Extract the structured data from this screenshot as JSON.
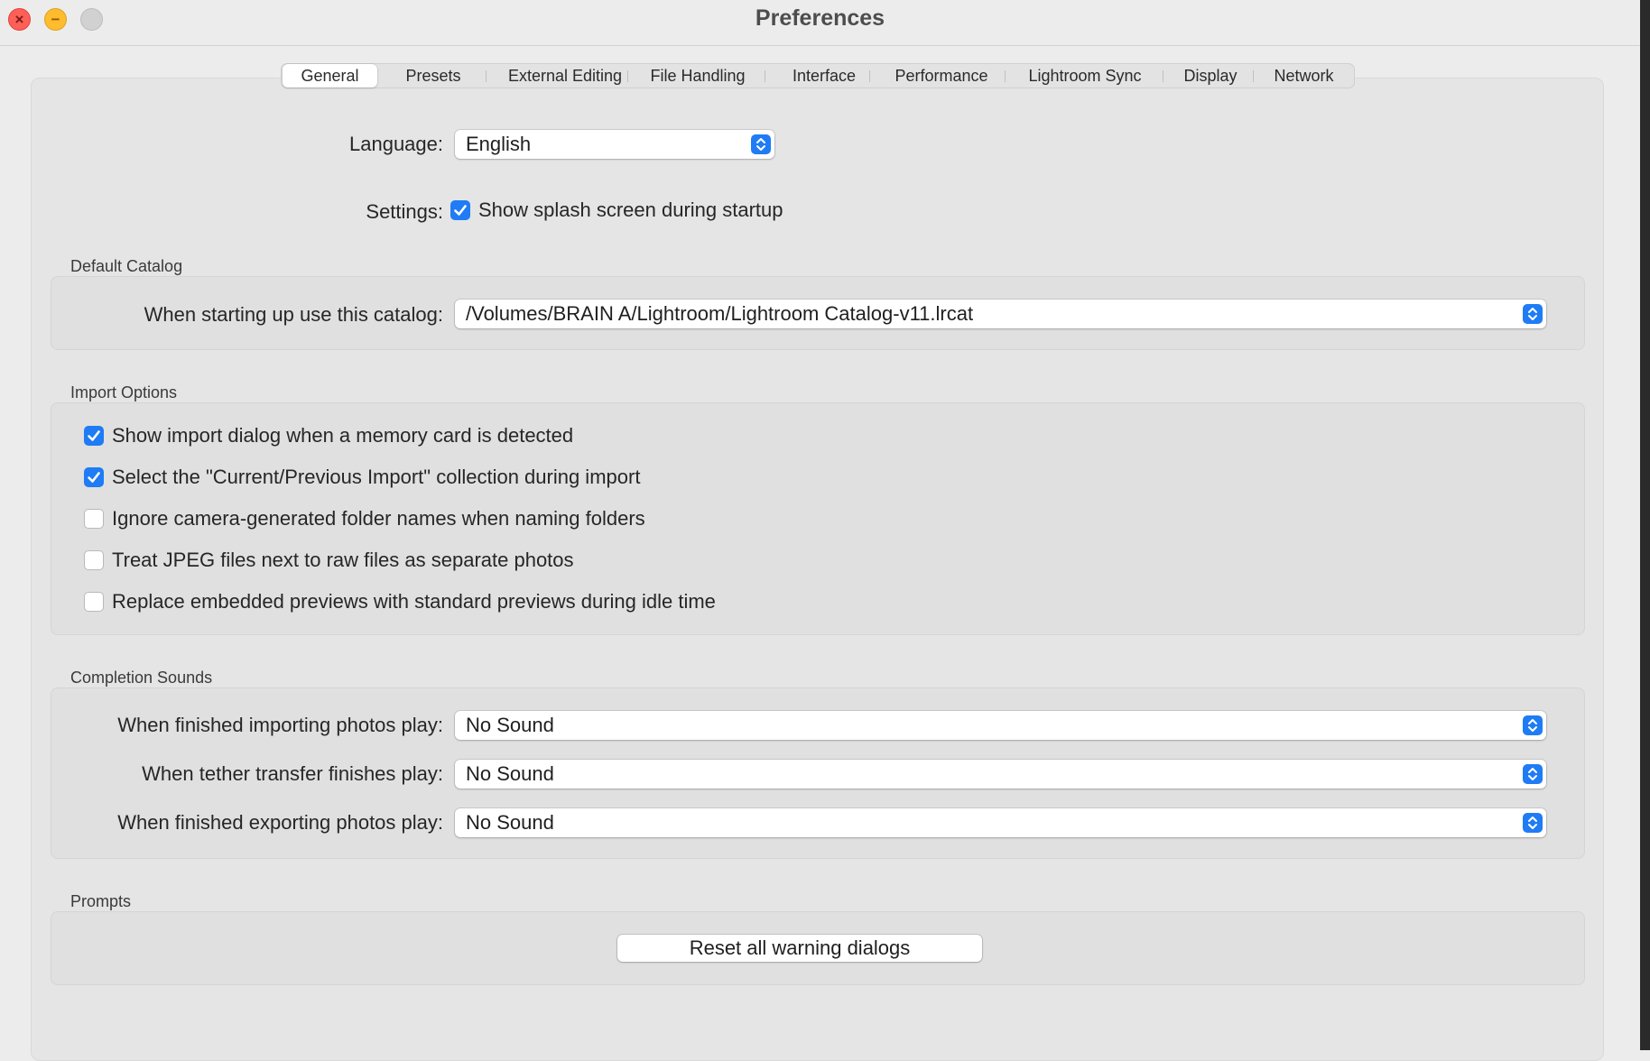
{
  "window": {
    "title": "Preferences"
  },
  "tabs": [
    {
      "label": "General",
      "active": true
    },
    {
      "label": "Presets"
    },
    {
      "label": "External Editing"
    },
    {
      "label": "File Handling"
    },
    {
      "label": "Interface"
    },
    {
      "label": "Performance"
    },
    {
      "label": "Lightroom Sync"
    },
    {
      "label": "Display"
    },
    {
      "label": "Network"
    }
  ],
  "general": {
    "language_label": "Language:",
    "language_value": "English",
    "settings_label": "Settings:",
    "splash_label": "Show splash screen during startup",
    "splash_checked": true
  },
  "default_catalog": {
    "title": "Default Catalog",
    "label": "When starting up use this catalog:",
    "value": "/Volumes/BRAIN A/Lightroom/Lightroom Catalog-v11.lrcat"
  },
  "import_options": {
    "title": "Import Options",
    "options": [
      {
        "label": "Show import dialog when a memory card is detected",
        "checked": true
      },
      {
        "label": "Select the \"Current/Previous Import\" collection during import",
        "checked": true
      },
      {
        "label": "Ignore camera-generated folder names when naming folders",
        "checked": false
      },
      {
        "label": "Treat JPEG files next to raw files as separate photos",
        "checked": false
      },
      {
        "label": "Replace embedded previews with standard previews during idle time",
        "checked": false
      }
    ]
  },
  "completion_sounds": {
    "title": "Completion Sounds",
    "rows": [
      {
        "label": "When finished importing photos play:",
        "value": "No Sound"
      },
      {
        "label": "When tether transfer finishes play:",
        "value": "No Sound"
      },
      {
        "label": "When finished exporting photos play:",
        "value": "No Sound"
      }
    ]
  },
  "prompts": {
    "title": "Prompts",
    "reset_button": "Reset all warning dialogs"
  },
  "colors": {
    "accent": "#1f7cf5",
    "close": "#fe5f57",
    "minimize": "#febc2e",
    "zoom_inactive": "#d1d1d1"
  },
  "icons": [
    "close-icon",
    "minimize-icon",
    "zoom-icon",
    "checkmark-icon",
    "popup-stepper-icon"
  ]
}
